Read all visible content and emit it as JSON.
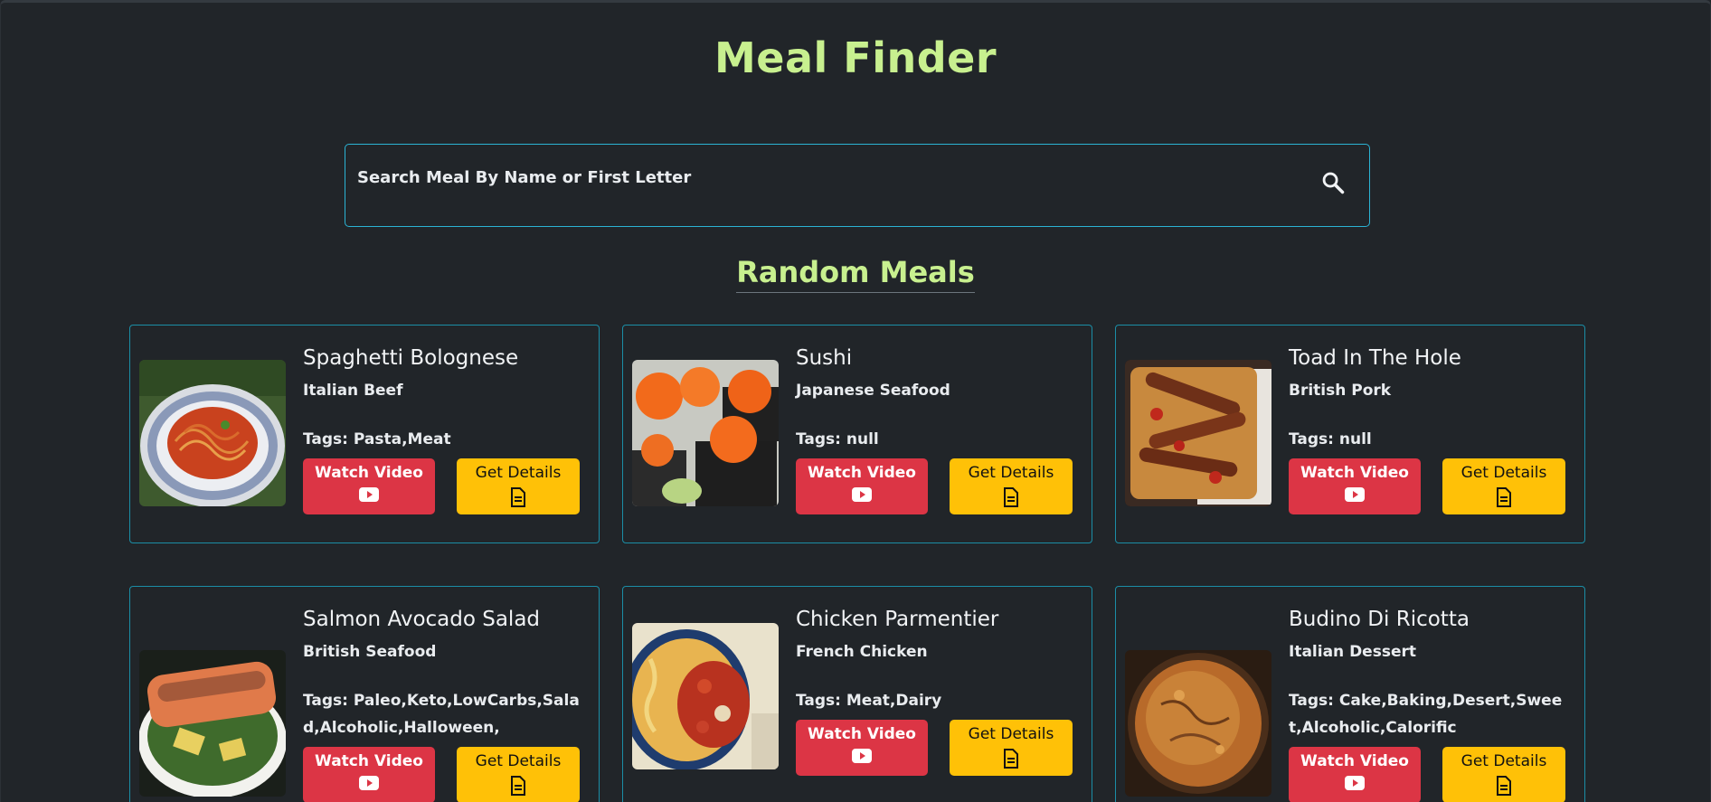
{
  "header": {
    "title": "Meal Finder"
  },
  "search": {
    "placeholder": "Search Meal By Name or First Letter",
    "icon": "search-icon"
  },
  "section": {
    "title": "Random Meals"
  },
  "buttons": {
    "video_label": "Watch Video",
    "details_label": "Get Details",
    "video_icon": "youtube-icon",
    "details_icon": "document-icon"
  },
  "colors": {
    "background": "#212529",
    "accent_title": "#c8f08f",
    "card_border": "#1b8ea6",
    "search_border": "#2bb3d4",
    "video_button": "#dc3545",
    "details_button": "#ffc107"
  },
  "meals": [
    {
      "name": "Spaghetti Bolognese",
      "area": "Italian Beef",
      "tags": "Tags: Pasta,Meat"
    },
    {
      "name": "Sushi",
      "area": "Japanese Seafood",
      "tags": "Tags: null"
    },
    {
      "name": "Toad In The Hole",
      "area": "British Pork",
      "tags": "Tags: null"
    },
    {
      "name": "Salmon Avocado Salad",
      "area": "British Seafood",
      "tags": "Tags: Paleo,Keto,LowCarbs,Salad,Alcoholic,Halloween,"
    },
    {
      "name": "Chicken Parmentier",
      "area": "French Chicken",
      "tags": "Tags: Meat,Dairy"
    },
    {
      "name": "Budino Di Ricotta",
      "area": "Italian Dessert",
      "tags": "Tags: Cake,Baking,Desert,Sweet,Alcoholic,Calorific"
    }
  ]
}
